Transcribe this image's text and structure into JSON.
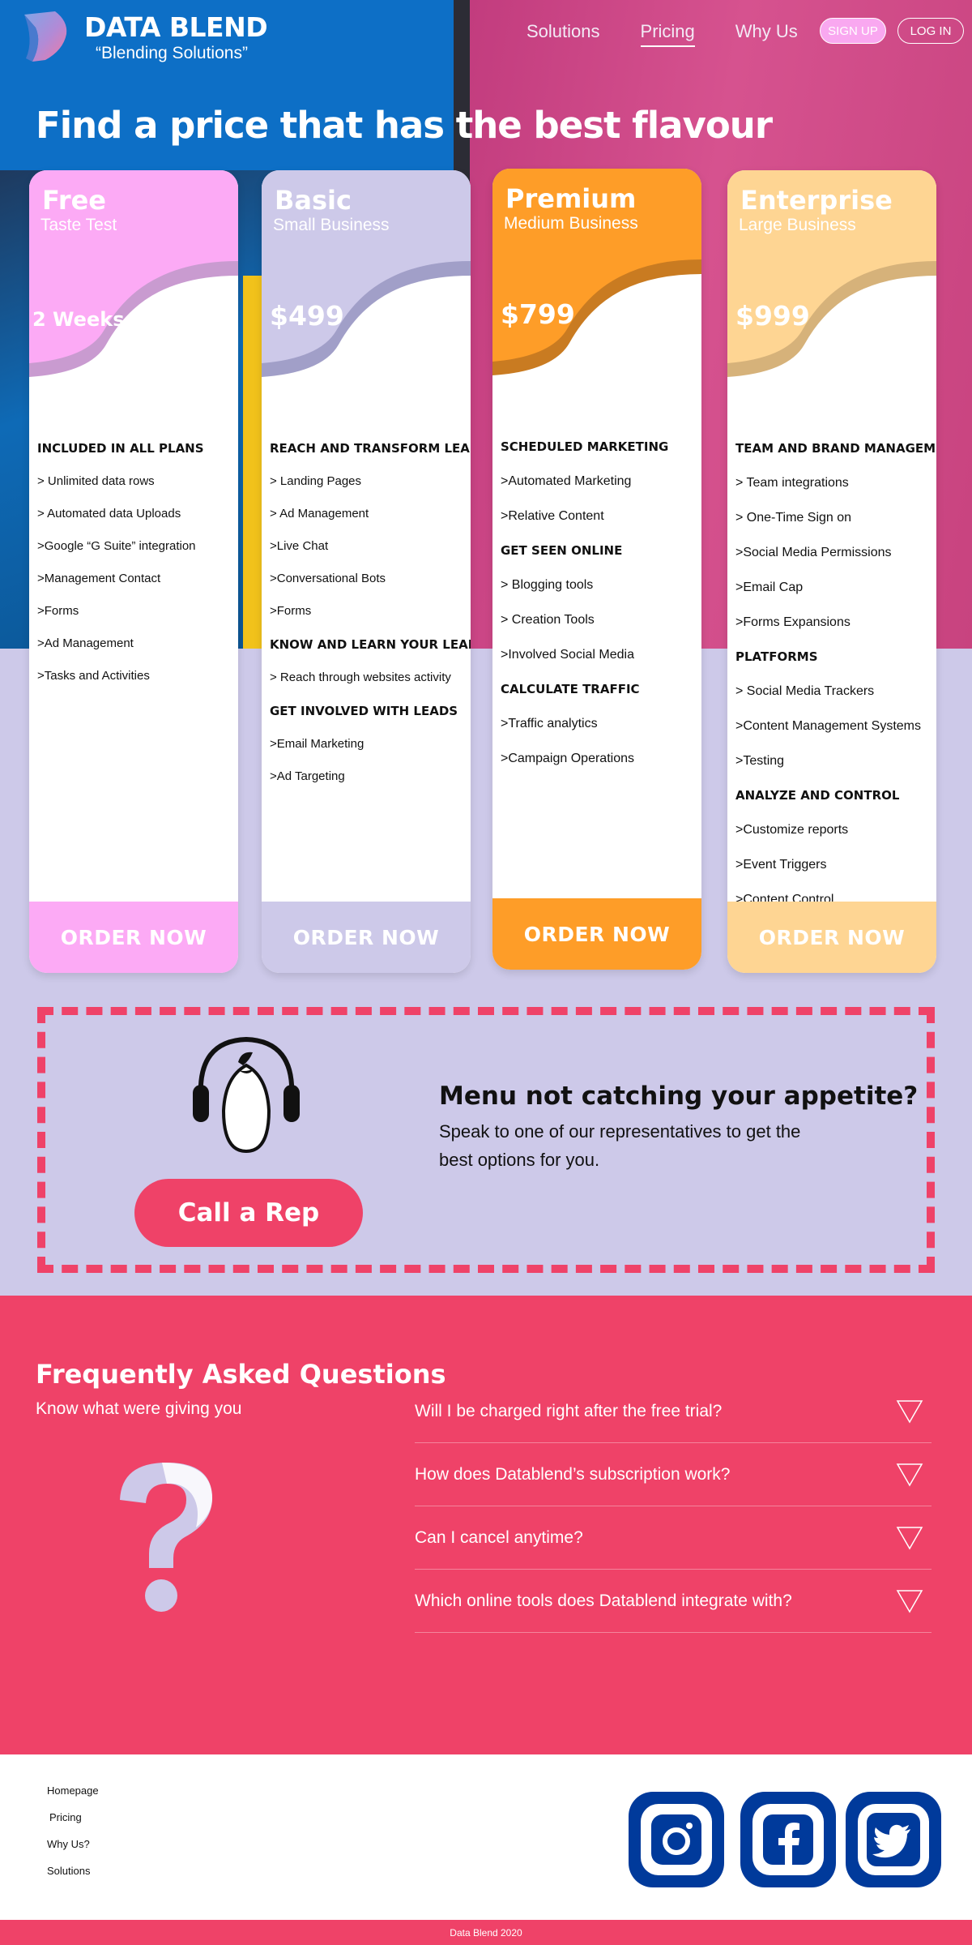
{
  "brand": {
    "name": "DATA BLEND",
    "tagline": "“Blending Solutions”"
  },
  "nav": {
    "items": [
      {
        "label": "Solutions"
      },
      {
        "label": "Pricing"
      },
      {
        "label": "Why Us"
      }
    ],
    "signup": "SIGN UP",
    "login": "LOG IN"
  },
  "hero": {
    "title": "Find a price that has the best flavour"
  },
  "plans": [
    {
      "name": "Free",
      "subtitle": "Taste Test",
      "price": "2 Weeks",
      "cta": "ORDER NOW",
      "colors": {
        "head": "#fcaaf5",
        "curve": "#c99bd0",
        "footer": "#fcaaf5"
      },
      "features": [
        {
          "type": "h",
          "text": "INCLUDED IN ALL PLANS"
        },
        {
          "type": "i",
          "text": "> Unlimited data rows"
        },
        {
          "type": "i",
          "text": "> Automated data Uploads"
        },
        {
          "type": "i",
          "text": ">Google “G Suite” integration"
        },
        {
          "type": "i",
          "text": ">Management Contact"
        },
        {
          "type": "i",
          "text": ">Forms"
        },
        {
          "type": "i",
          "text": ">Ad Management"
        },
        {
          "type": "i",
          "text": ">Tasks and Activities"
        }
      ]
    },
    {
      "name": "Basic",
      "subtitle": "Small Business",
      "price": "$499",
      "cta": "ORDER NOW",
      "colors": {
        "head": "#cdc9e9",
        "curve": "#a19fc8",
        "footer": "#cdc9e9"
      },
      "features": [
        {
          "type": "h",
          "text": "REACH AND TRANSFORM LEADS"
        },
        {
          "type": "i",
          "text": "> Landing Pages"
        },
        {
          "type": "i",
          "text": "> Ad Management"
        },
        {
          "type": "i",
          "text": ">Live Chat"
        },
        {
          "type": "i",
          "text": ">Conversational Bots"
        },
        {
          "type": "i",
          "text": ">Forms"
        },
        {
          "type": "h",
          "text": "KNOW AND LEARN YOUR LEADS"
        },
        {
          "type": "i",
          "text": "> Reach through websites activity"
        },
        {
          "type": "h",
          "text": "GET INVOLVED WITH LEADS"
        },
        {
          "type": "i",
          "text": ">Email Marketing"
        },
        {
          "type": "i",
          "text": ">Ad Targeting"
        }
      ]
    },
    {
      "name": "Premium",
      "subtitle": "Medium Business",
      "price": "$799",
      "cta": "ORDER NOW",
      "colors": {
        "head": "#fe9d28",
        "curve": "#c97b21",
        "footer": "#fe9d28"
      },
      "features": [
        {
          "type": "h",
          "text": "SCHEDULED MARKETING"
        },
        {
          "type": "i",
          "text": ">Automated Marketing"
        },
        {
          "type": "i",
          "text": ">Relative Content"
        },
        {
          "type": "h",
          "text": "GET SEEN ONLINE"
        },
        {
          "type": "i",
          "text": "> Blogging tools"
        },
        {
          "type": "i",
          "text": "> Creation Tools"
        },
        {
          "type": "i",
          "text": ">Involved Social Media"
        },
        {
          "type": "h",
          "text": "CALCULATE TRAFFIC"
        },
        {
          "type": "i",
          "text": ">Traffic analytics"
        },
        {
          "type": "i",
          "text": ">Campaign Operations"
        }
      ]
    },
    {
      "name": "Enterprise",
      "subtitle": "Large Business",
      "price": "$999",
      "cta": "ORDER NOW",
      "colors": {
        "head": "#fed593",
        "curve": "#d6b27a",
        "footer": "#fed593"
      },
      "features": [
        {
          "type": "h",
          "text": "TEAM AND BRAND MANAGEMENT"
        },
        {
          "type": "i",
          "text": "> Team integrations"
        },
        {
          "type": "i",
          "text": "> One-Time Sign on"
        },
        {
          "type": "i",
          "text": ">Social Media Permissions"
        },
        {
          "type": "i",
          "text": ">Email Cap"
        },
        {
          "type": "i",
          "text": ">Forms Expansions"
        },
        {
          "type": "h",
          "text": "PLATFORMS"
        },
        {
          "type": "i",
          "text": "> Social Media Trackers"
        },
        {
          "type": "i",
          "text": ">Content Management Systems"
        },
        {
          "type": "i",
          "text": ">Testing"
        },
        {
          "type": "h",
          "text": "ANALYZE AND CONTROL"
        },
        {
          "type": "i",
          "text": ">Customize reports"
        },
        {
          "type": "i",
          "text": ">Event Triggers"
        },
        {
          "type": "i",
          "text": ">Content Control"
        }
      ]
    }
  ],
  "cta": {
    "title": "Menu not catching your appetite?",
    "text": "Speak to one of our representatives to get the best options for you.",
    "button": "Call a Rep",
    "icon": "headphones-icon"
  },
  "faq": {
    "title": "Frequently Asked Questions",
    "subtitle": "Know what were giving you",
    "questions": [
      "Will I be charged right after the free trial?",
      "How does Datablend’s subscription work?",
      "Can I cancel anytime?",
      "Which online tools does Datablend integrate with?"
    ]
  },
  "footer": {
    "links": [
      "Homepage",
      "Pricing",
      "Why Us?",
      "Solutions"
    ],
    "social": [
      "instagram-icon",
      "facebook-icon",
      "twitter-icon"
    ],
    "copyright": "Data Blend 2020"
  },
  "colors": {
    "accent": "#ef4268",
    "lavender": "#cdc9e9",
    "social_blue": "#003a9b"
  }
}
